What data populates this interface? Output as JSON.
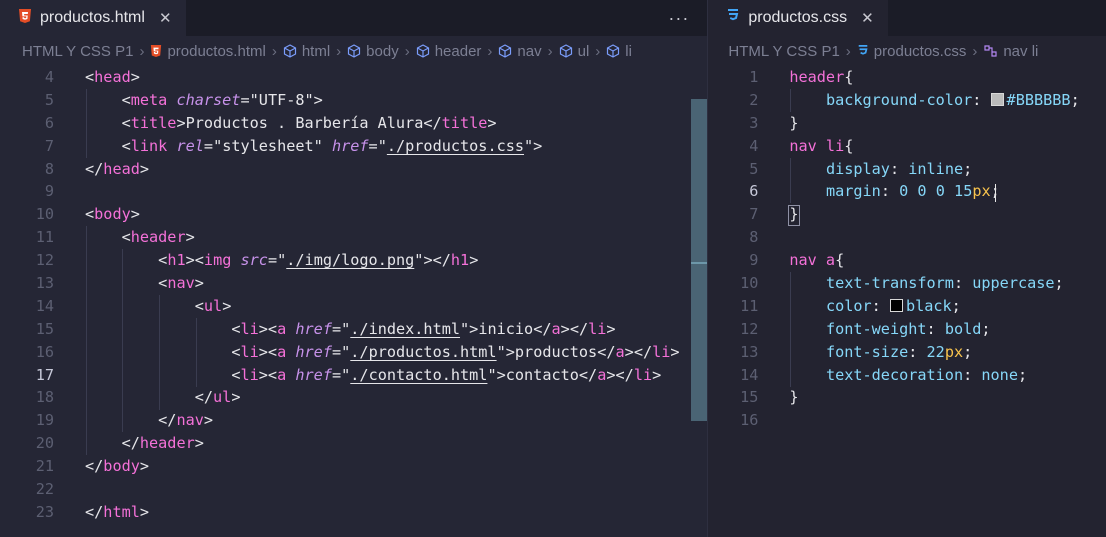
{
  "left_pane": {
    "tab": {
      "icon": "html5-icon",
      "label": "productos.html"
    },
    "more": "···",
    "breadcrumb": [
      "HTML Y CSS P1",
      "productos.html",
      "html",
      "body",
      "header",
      "nav",
      "ul",
      "li"
    ],
    "lines": [
      {
        "n": "4",
        "text": "<head>"
      },
      {
        "n": "5",
        "text": "    <meta charset=\"UTF-8\">"
      },
      {
        "n": "6",
        "text": "    <title>Productos . Barbería Alura</title>"
      },
      {
        "n": "7",
        "text": "    <link rel=\"stylesheet\" href=\"./productos.css\">"
      },
      {
        "n": "8",
        "text": "</head>"
      },
      {
        "n": "9",
        "text": ""
      },
      {
        "n": "10",
        "text": "<body>"
      },
      {
        "n": "11",
        "text": "    <header>"
      },
      {
        "n": "12",
        "text": "        <h1><img src=\"./img/logo.png\"></h1>"
      },
      {
        "n": "13",
        "text": "        <nav>"
      },
      {
        "n": "14",
        "text": "            <ul>"
      },
      {
        "n": "15",
        "text": "                <li><a href=\"./index.html\">inicio</a></li>"
      },
      {
        "n": "16",
        "text": "                <li><a href=\"./productos.html\">productos</a></li>"
      },
      {
        "n": "17",
        "text": "                <li><a href=\"./contacto.html\">contacto</a></li>"
      },
      {
        "n": "18",
        "text": "            </ul>"
      },
      {
        "n": "19",
        "text": "        </nav>"
      },
      {
        "n": "20",
        "text": "    </header>"
      },
      {
        "n": "21",
        "text": "</body>"
      },
      {
        "n": "22",
        "text": ""
      },
      {
        "n": "23",
        "text": "</html>"
      }
    ],
    "active_line": "17"
  },
  "right_pane": {
    "tab": {
      "icon": "css3-icon",
      "label": "productos.css"
    },
    "breadcrumb": [
      "HTML Y CSS P1",
      "productos.css",
      "nav li"
    ],
    "lines": [
      {
        "n": "1",
        "text": "header{"
      },
      {
        "n": "2",
        "text": "    background-color: #BBBBBB;"
      },
      {
        "n": "3",
        "text": "}"
      },
      {
        "n": "4",
        "text": "nav li{"
      },
      {
        "n": "5",
        "text": "    display: inline;"
      },
      {
        "n": "6",
        "text": "    margin: 0 0 0 15px;"
      },
      {
        "n": "7",
        "text": "}"
      },
      {
        "n": "8",
        "text": ""
      },
      {
        "n": "9",
        "text": "nav a{"
      },
      {
        "n": "10",
        "text": "    text-transform: uppercase;"
      },
      {
        "n": "11",
        "text": "    color: black;"
      },
      {
        "n": "12",
        "text": "    font-weight: bold;"
      },
      {
        "n": "13",
        "text": "    font-size: 22px;"
      },
      {
        "n": "14",
        "text": "    text-decoration: none;"
      },
      {
        "n": "15",
        "text": "}"
      },
      {
        "n": "16",
        "text": ""
      }
    ],
    "active_line": "6",
    "swatch_colors": {
      "line2": "#BBBBBB",
      "line11": "#000000"
    }
  }
}
